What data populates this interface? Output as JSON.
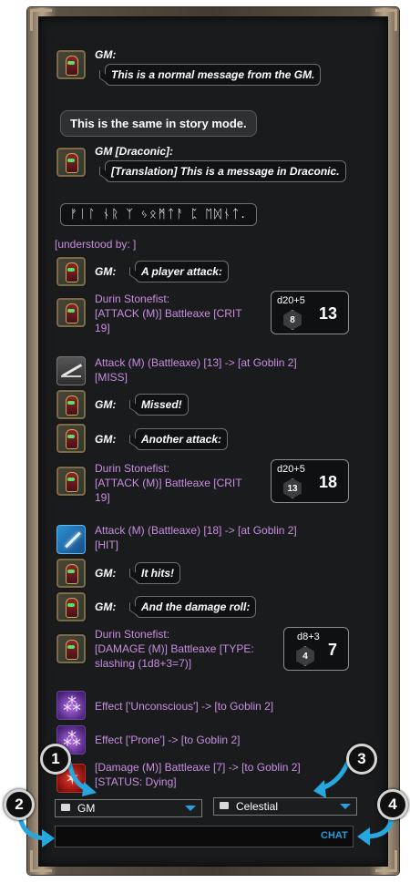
{
  "chat_log": {
    "gm_normal": {
      "sender": "GM:",
      "text": "This is a normal message from the GM."
    },
    "story": {
      "text": "This is the same in story mode."
    },
    "gm_draconic": {
      "sender": "GM [Draconic]:",
      "text": "[Translation] This is a message in Draconic."
    },
    "draconic_script": {
      "text": "ᚠᛁᛚ ᚾᚱ ᛉ ᛃᛟᛗᛏᚨ ᛈ ᛖᛞᚾᛏ."
    },
    "understood_by": "[understood by: ]",
    "gm_player_attack": {
      "sender": "GM:",
      "text": "A player attack:"
    },
    "attack_roll_1": {
      "line1": "Durin Stonefist:",
      "line2": "[ATTACK (M)] Battleaxe [CRIT",
      "line3": "19]",
      "dice_formula": "d20+5",
      "die_value": "8",
      "total": "13"
    },
    "attack_result_miss": {
      "line1": "Attack (M) (Battleaxe) [13] -> [at Goblin 2]",
      "line2": "[MISS]"
    },
    "gm_missed": {
      "sender": "GM:",
      "text": "Missed!"
    },
    "gm_another_attack": {
      "sender": "GM:",
      "text": "Another attack:"
    },
    "attack_roll_2": {
      "line1": "Durin Stonefist:",
      "line2": "[ATTACK (M)] Battleaxe [CRIT",
      "line3": "19]",
      "dice_formula": "d20+5",
      "die_value": "13",
      "total": "18"
    },
    "attack_result_hit": {
      "line1": "Attack (M) (Battleaxe) [18] -> [at Goblin 2]",
      "line2": "[HIT]"
    },
    "gm_it_hits": {
      "sender": "GM:",
      "text": "It hits!"
    },
    "gm_damage_roll": {
      "sender": "GM:",
      "text": "And the damage roll:"
    },
    "damage_roll": {
      "line1": "Durin Stonefist:",
      "line2": "[DAMAGE (M)] Battleaxe [TYPE:",
      "line3": "slashing (1d8+3=7)]",
      "dice_formula": "d8+3",
      "die_value": "4",
      "total": "7"
    },
    "effect_unconscious": "Effect ['Unconscious'] -> [to Goblin 2]",
    "effect_prone": "Effect ['Prone'] -> [to Goblin 2]",
    "damage_result": {
      "line1": "[Damage (M)] Battleaxe [7] -> [to Goblin 2]",
      "line2": "[STATUS: Dying]"
    }
  },
  "controls": {
    "identity_selector": "GM",
    "language_selector": "Celestial",
    "chat_button": "CHAT"
  },
  "callouts": [
    "1",
    "2",
    "3",
    "4"
  ],
  "icons": {
    "avatar": "character-portrait-icon",
    "miss": "miss-icon",
    "hit": "sword-hit-icon",
    "effect": "effect-icon",
    "damage": "damage-icon",
    "chat_bubble": "chat-bubble-icon",
    "dropdown": "caret-down-icon"
  },
  "colors": {
    "panel_background": "#1a1b1d",
    "system_text": "#c88fe0",
    "accent": "#2a9fd8",
    "frame": "#b5a183"
  }
}
